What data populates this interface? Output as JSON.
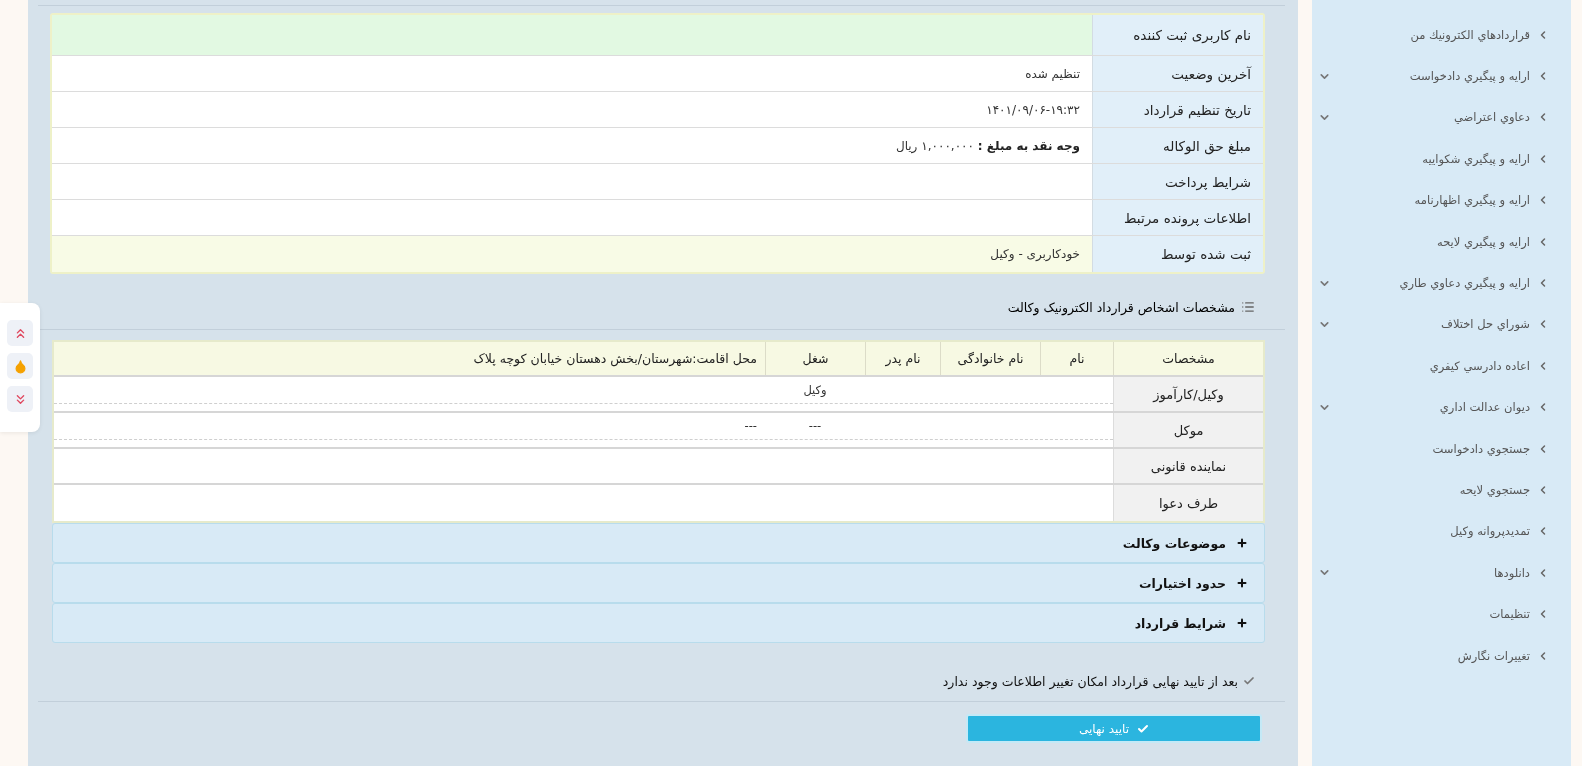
{
  "contract_info": {
    "rows": [
      {
        "label": "نام کاربری ثبت کننده",
        "color": "#e2f9e2"
      },
      {
        "label": "آخرین وضعیت",
        "value": "تنظیم شده"
      },
      {
        "label": "تاریخ تنظیم قرارداد",
        "value": "۱۴۰۱/۰۹/۰۶-۱۹:۳۲"
      },
      {
        "label": "مبلغ حق الوکاله",
        "value": "**وجه نقد به مبلغ :** ۱,۰۰۰,۰۰۰ ریال"
      },
      {
        "label": "شرایط پرداخت"
      },
      {
        "label": "اطلاعات پرونده مرتبط"
      },
      {
        "label": "ثبت شده توسط",
        "value": "خودکاربری - وکیل",
        "color": "#f8fbe6"
      }
    ]
  },
  "parties": {
    "title": "مشخصات اشخاص قرارداد الکترونیک وکالت",
    "columns": [
      "مشخصات",
      "نام",
      "نام خانوادگی",
      "نام پدر",
      "شغل",
      "محل اقامت:شهرستان/بخش دهستان خیابان کوچه پلاک"
    ],
    "rows": [
      {
        "label": "وکیل/کارآموز",
        "kind": "detail",
        "occupation": "وکیل"
      },
      {
        "label": "موکل",
        "kind": "detail",
        "occupation": "---",
        "residence": "---"
      },
      {
        "label": "نماینده قانونی",
        "kind": "blank"
      },
      {
        "label": "طرف دعوا",
        "kind": "blank"
      }
    ]
  },
  "accordions": [
    {
      "title": "موضوعات وکالت",
      "expanded": false
    },
    {
      "title": "حدود اختیارات",
      "expanded": false
    },
    {
      "title": "شرایط قرارداد",
      "expanded": false
    }
  ],
  "notice": "بعد از تایید نهایی قرارداد امکان تغییر اطلاعات وجود ندارد",
  "confirm_button": "تایید نهایی",
  "sidebar": {
    "items": [
      {
        "label": "قراردادهاي الكترونيك من",
        "has_submenu": false
      },
      {
        "label": "ارايه و پيگيري دادخواست",
        "has_submenu": true
      },
      {
        "label": "دعاوي اعتراضي",
        "has_submenu": true
      },
      {
        "label": "ارايه و پيگيري شكواييه",
        "has_submenu": false
      },
      {
        "label": "ارايه و پيگيري اظهارنامه",
        "has_submenu": false
      },
      {
        "label": "ارايه و پيگيري لايحه",
        "has_submenu": false
      },
      {
        "label": "ارايه و پيگيري دعاوي طاري",
        "has_submenu": true
      },
      {
        "label": "شوراي حل اختلاف",
        "has_submenu": true
      },
      {
        "label": "اعاده دادرسي كيفري",
        "has_submenu": false
      },
      {
        "label": "ديوان عدالت اداري",
        "has_submenu": true
      },
      {
        "label": "جستجوي دادخواست",
        "has_submenu": false
      },
      {
        "label": "جستجوي لايحه",
        "has_submenu": false
      },
      {
        "label": "تمديدپروانه وكيل",
        "has_submenu": false
      },
      {
        "label": "دانلودها",
        "has_submenu": true
      },
      {
        "label": "تنظيمات",
        "has_submenu": false
      },
      {
        "label": "تغييرات نگارش",
        "has_submenu": false
      }
    ]
  }
}
